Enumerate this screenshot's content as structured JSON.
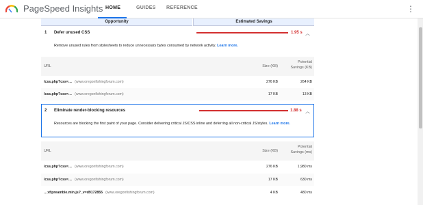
{
  "app": {
    "title": "PageSpeed Insights"
  },
  "nav": {
    "tabs": [
      {
        "label": "HOME"
      },
      {
        "label": "GUIDES"
      },
      {
        "label": "REFERENCE"
      }
    ]
  },
  "table_header": {
    "opportunity": "Opportunity",
    "savings": "Estimated Savings"
  },
  "opportunities": [
    {
      "number": "1",
      "title": "Defer unused CSS",
      "savings": "1.95 s",
      "description": "Remove unused rules from stylesheets to reduce unnecessary bytes consumed by network activity.",
      "learn_more": "Learn more.",
      "columns": {
        "url": "URL",
        "size": "Size (KB)",
        "savings": "Potential Savings (KB)"
      },
      "rows": [
        {
          "url": "/css.php?css=…",
          "host": "(www.oregonfishingforum.com)",
          "size": "276 KB",
          "savings": "264 KB"
        },
        {
          "url": "/css.php?css=…",
          "host": "(www.oregonfishingforum.com)",
          "size": "17 KB",
          "savings": "13 KB"
        }
      ]
    },
    {
      "number": "2",
      "title": "Eliminate render-blocking resources",
      "savings": "1.88 s",
      "description": "Resources are blocking the first paint of your page. Consider delivering critical JS/CSS inline and deferring all non-critical JS/styles.",
      "learn_more": "Learn more.",
      "columns": {
        "url": "URL",
        "size": "Size (KB)",
        "savings": "Potential Savings (ms)"
      },
      "rows": [
        {
          "url": "/css.php?css=…",
          "host": "(www.oregonfishingforum.com)",
          "size": "276 KB",
          "savings": "1,980 ms"
        },
        {
          "url": "/css.php?css=…",
          "host": "(www.oregonfishingforum.com)",
          "size": "17 KB",
          "savings": "630 ms"
        },
        {
          "url": "…xf/preamble.min.js?_v=d9172855",
          "host": "(www.oregonfishingforum.com)",
          "size": "4 KB",
          "savings": "480 ms"
        }
      ]
    }
  ],
  "colors": {
    "accent": "#1a73e8",
    "savings_red": "#d32f2f",
    "header_bg": "#e8f0fe"
  },
  "icons": {
    "logo": "pagespeed-gauge-icon",
    "menu": "more-vert-icon",
    "collapse": "chevron-up-icon"
  }
}
